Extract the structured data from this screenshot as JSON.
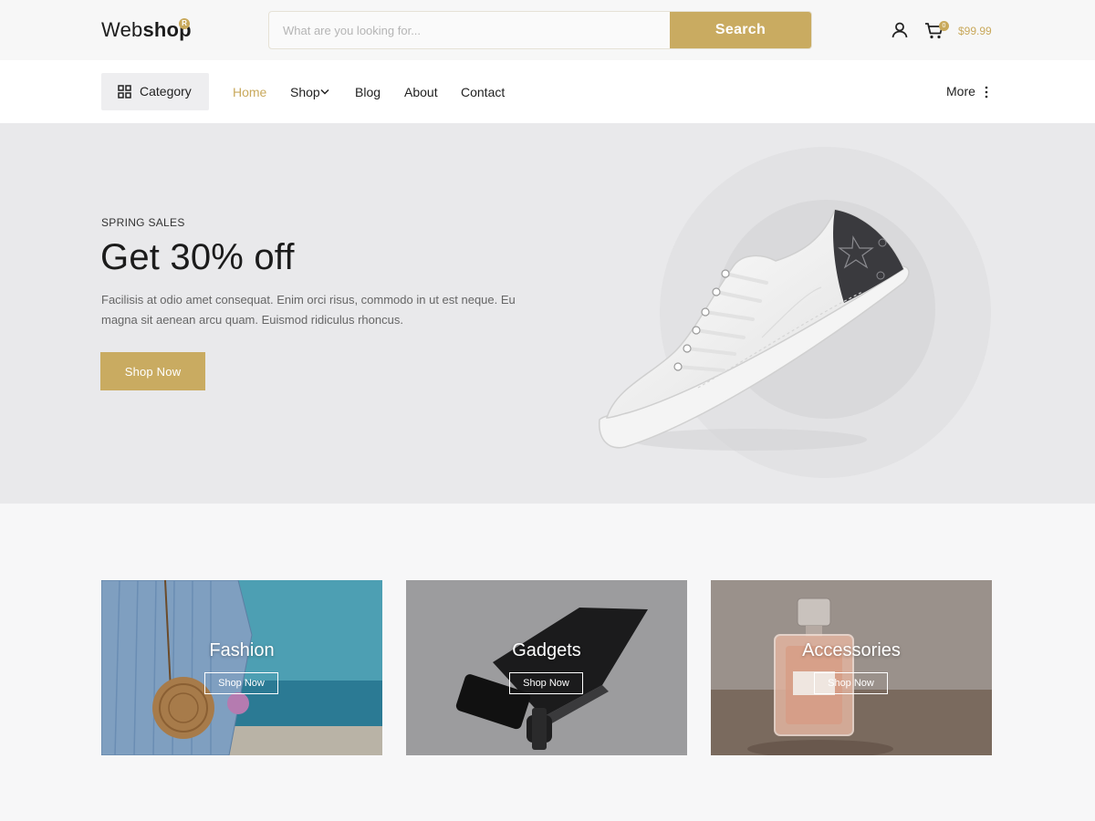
{
  "header": {
    "logo_regular": "Web",
    "logo_bold": "shop",
    "logo_badge": "R",
    "search_placeholder": "What are you looking for...",
    "search_button": "Search",
    "cart_count": "0",
    "cart_total": "$99.99"
  },
  "nav": {
    "category_label": "Category",
    "links": [
      "Home",
      "Shop",
      "Blog",
      "About",
      "Contact"
    ],
    "active": "Home",
    "more_label": "More"
  },
  "hero": {
    "kicker": "SPRING SALES",
    "title": "Get 30% off",
    "text": "Facilisis at odio amet consequat. Enim orci risus, commodo in ut est neque. Eu magna sit aenean arcu quam. Euismod ridiculus rhoncus.",
    "button": "Shop Now"
  },
  "categories": [
    {
      "title": "Fashion",
      "button": "Shop Now"
    },
    {
      "title": "Gadgets",
      "button": "Shop Now"
    },
    {
      "title": "Accessories",
      "button": "Shop Now"
    }
  ],
  "colors": {
    "accent": "#c9ab61",
    "hero_bg": "#e9e9eb",
    "page_bg": "#f7f7f8"
  },
  "icons": {
    "user": "user-icon",
    "cart": "cart-icon",
    "category": "grid-icon",
    "shop_dropdown": "chevron-down-icon",
    "more": "vertical-dots-icon"
  }
}
